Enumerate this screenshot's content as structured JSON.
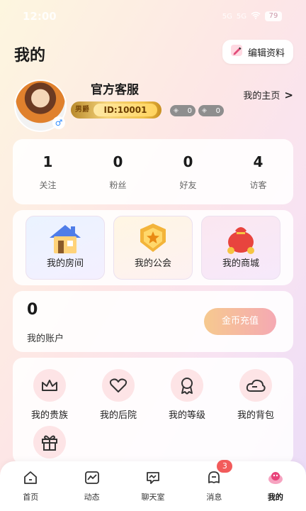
{
  "status_bar": {
    "time": "12:00",
    "signal1": "5G",
    "signal2": "5G",
    "battery": "79"
  },
  "header": {
    "title": "我的",
    "edit_label": "编辑资料"
  },
  "profile": {
    "nickname": "官方客服",
    "crest_text": "男爵",
    "id_text": "ID:10001",
    "gender_symbol": "♂",
    "badge1_count": "0",
    "badge2_count": "0",
    "homepage_label": "我的主页",
    "homepage_chevron": ">"
  },
  "stats": [
    {
      "value": "1",
      "label": "关注"
    },
    {
      "value": "0",
      "label": "粉丝"
    },
    {
      "value": "0",
      "label": "好友"
    },
    {
      "value": "4",
      "label": "访客"
    }
  ],
  "shortcuts": [
    {
      "label": "我的房间",
      "icon": "house-icon"
    },
    {
      "label": "我的公会",
      "icon": "star-shield-icon"
    },
    {
      "label": "我的商城",
      "icon": "money-bag-icon"
    }
  ],
  "account": {
    "balance": "0",
    "label": "我的账户",
    "recharge_label": "金币充值"
  },
  "menu": [
    {
      "label": "我的贵族",
      "icon": "crown-icon"
    },
    {
      "label": "我的后院",
      "icon": "heart-icon"
    },
    {
      "label": "我的等级",
      "icon": "medal-icon"
    },
    {
      "label": "我的背包",
      "icon": "cloud-icon"
    },
    {
      "label": "",
      "icon": "gift-icon"
    }
  ],
  "tabbar": [
    {
      "label": "首页",
      "icon": "home-icon"
    },
    {
      "label": "动态",
      "icon": "activity-icon"
    },
    {
      "label": "聊天室",
      "icon": "chat-room-icon"
    },
    {
      "label": "消息",
      "icon": "message-icon",
      "badge": "3"
    },
    {
      "label": "我的",
      "icon": "me-icon",
      "active": true
    }
  ],
  "colors": {
    "accent_pink": "#f5a9b3",
    "accent_gold": "#f0c24a",
    "badge_red": "#f25b5b"
  }
}
